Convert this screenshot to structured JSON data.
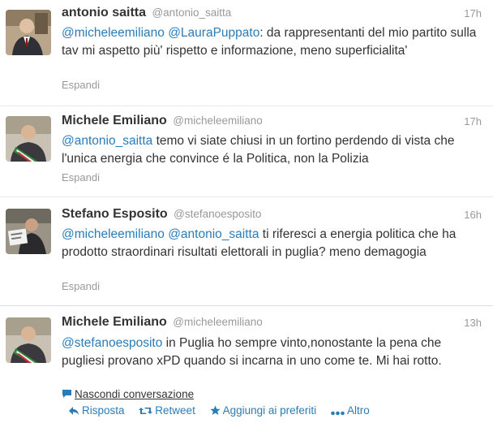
{
  "tweets": [
    {
      "fullname": "antonio saitta",
      "username": "@antonio_saitta",
      "time": "17h",
      "mentions": [
        "@micheleemiliano",
        "@LauraPuppato"
      ],
      "text_after": ": da rappresentanti del mio partito sulla tav mi aspetto più' rispetto e informazione, meno superficialita'",
      "expand": "Espandi"
    },
    {
      "fullname": "Michele Emiliano",
      "username": "@micheleemiliano",
      "time": "17h",
      "mentions": [
        "@antonio_saitta"
      ],
      "text_after": " temo vi siate chiusi in un fortino perdendo di vista che l'unica energia che convince é la Politica, non la Polizia",
      "expand": "Espandi"
    },
    {
      "fullname": "Stefano Esposito",
      "username": "@stefanoesposito",
      "time": "16h",
      "mentions": [
        "@micheleemiliano",
        "@antonio_saitta"
      ],
      "text_after": " ti riferesci a energia politica che ha prodotto straordinari risultati elettorali in puglia? meno demagogia",
      "expand": "Espandi"
    },
    {
      "fullname": "Michele Emiliano",
      "username": "@micheleemiliano",
      "time": "13h",
      "mentions": [
        "@stefanoesposito"
      ],
      "text_after": " in Puglia ho sempre vinto,nonostante la pena che pugliesi provano xPD quando si incarna in uno come te. Mi hai rotto.",
      "hide_conversation": "Nascondi conversazione",
      "actions": {
        "reply": "Risposta",
        "retweet": "Retweet",
        "favorite": "Aggiungi ai preferiti",
        "more": "Altro"
      }
    }
  ],
  "colors": {
    "link": "#2a7cb8",
    "meta": "#999999",
    "text": "#333333",
    "divider": "#e8e8e8"
  }
}
